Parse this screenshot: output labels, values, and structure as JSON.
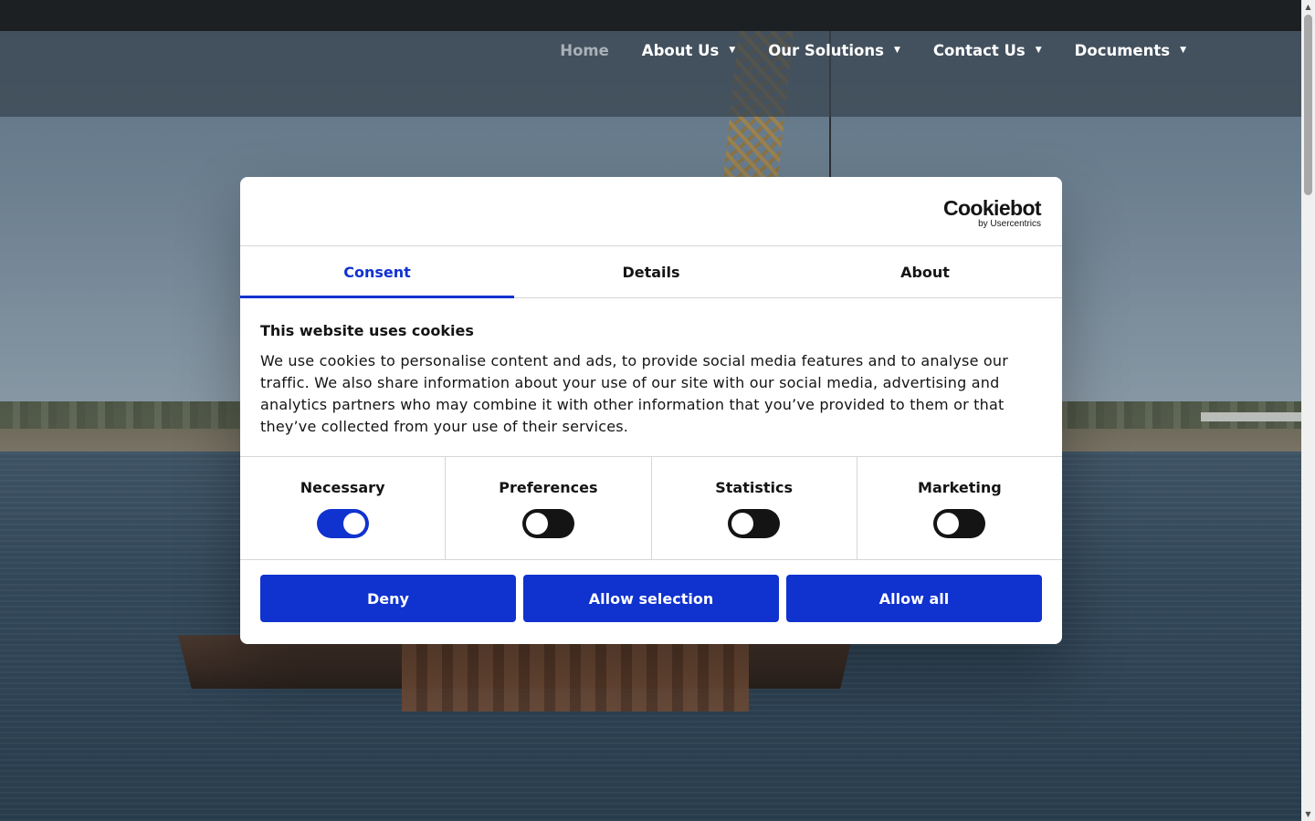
{
  "nav": {
    "items": [
      {
        "label": "Home",
        "has_caret": false,
        "active": true
      },
      {
        "label": "About Us",
        "has_caret": true,
        "active": false
      },
      {
        "label": "Our Solutions",
        "has_caret": true,
        "active": false
      },
      {
        "label": "Contact Us",
        "has_caret": true,
        "active": false
      },
      {
        "label": "Documents",
        "has_caret": true,
        "active": false
      }
    ],
    "caret_icon": "caret-down-icon"
  },
  "dialog": {
    "logo": {
      "main": "Cookiebot",
      "sub": "by Usercentrics"
    },
    "tabs": [
      {
        "label": "Consent",
        "active": true
      },
      {
        "label": "Details",
        "active": false
      },
      {
        "label": "About",
        "active": false
      }
    ],
    "title": "This website uses cookies",
    "body": "We use cookies to personalise content and ads, to provide social media features and to analyse our traffic. We also share information about your use of our site with our social media, advertising and analytics partners who may combine it with other information that you’ve provided to them or that they’ve collected from your use of their services.",
    "toggles": [
      {
        "label": "Necessary",
        "checked": true
      },
      {
        "label": "Preferences",
        "checked": false
      },
      {
        "label": "Statistics",
        "checked": false
      },
      {
        "label": "Marketing",
        "checked": false
      }
    ],
    "buttons": {
      "deny": "Deny",
      "allow_selection": "Allow selection",
      "allow_all": "Allow all"
    }
  },
  "colors": {
    "accent": "#1032cf",
    "topbar": "#1c2023",
    "toggle_off": "#141414"
  }
}
